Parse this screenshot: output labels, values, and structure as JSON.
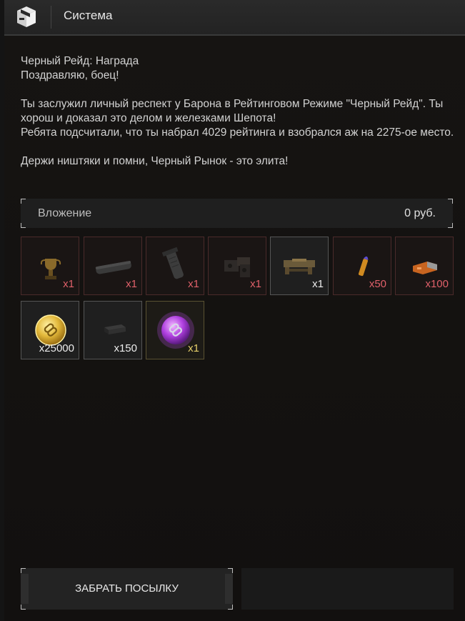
{
  "header": {
    "title": "Система",
    "icon": "package-box-icon"
  },
  "message": {
    "subject": "Черный Рейд: Награда",
    "greeting": "Поздравляю, боец!",
    "body1": "Ты заслужил личный респект у Барона в Рейтинговом Режиме \"Черный Рейд\". Ты хорош и доказал это делом и железками Шепота!",
    "body2": "Ребята подсчитали, что ты набрал 4029 рейтинга и взобрался аж на 2275-ое место.",
    "closing": "Держи ништяки и помни, Черный Рынок - это элита!"
  },
  "attachment": {
    "label": "Вложение",
    "price": "0 руб."
  },
  "items": [
    {
      "icon": "trophy-icon",
      "qty": "x1",
      "rarity": "red"
    },
    {
      "icon": "suppressor-icon",
      "qty": "x1",
      "rarity": "red"
    },
    {
      "icon": "grip-icon",
      "qty": "x1",
      "rarity": "red"
    },
    {
      "icon": "weapon-part-icon",
      "qty": "x1",
      "rarity": "red"
    },
    {
      "icon": "rail-mount-icon",
      "qty": "x1",
      "rarity": "white"
    },
    {
      "icon": "bullet-icon",
      "qty": "x50",
      "rarity": "red"
    },
    {
      "icon": "ammo-box-icon",
      "qty": "x100",
      "rarity": "red"
    },
    {
      "icon": "gold-token-icon",
      "qty": "x25000",
      "rarity": "white"
    },
    {
      "icon": "magazine-icon",
      "qty": "x150",
      "rarity": "white"
    },
    {
      "icon": "purple-token-icon",
      "qty": "x1",
      "rarity": "gold"
    }
  ],
  "actions": {
    "claim_label": "ЗАБРАТЬ ПОСЫЛКУ"
  }
}
